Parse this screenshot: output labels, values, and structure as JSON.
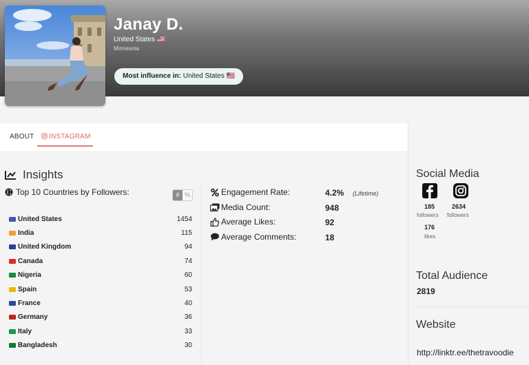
{
  "profile": {
    "name": "Janay D.",
    "country": "United States 🇺🇸",
    "region": "Minnesota",
    "influence_label": "Most influence in:",
    "influence_value": "United States 🇺🇸"
  },
  "tabs": [
    {
      "label": "ABOUT"
    },
    {
      "label": "INSTAGRAM"
    }
  ],
  "insights": {
    "title": "Insights",
    "countries_title": "Top 10 Countries by Followers:",
    "toggle": {
      "on": "#",
      "off": "%"
    },
    "countries": [
      {
        "name": "United States",
        "value": "1454",
        "flag": "#3b5ba9"
      },
      {
        "name": "India",
        "value": "115",
        "flag": "#f39c32"
      },
      {
        "name": "United Kingdom",
        "value": "94",
        "flag": "#2c3e8c"
      },
      {
        "name": "Canada",
        "value": "74",
        "flag": "#d72b2b"
      },
      {
        "name": "Nigeria",
        "value": "60",
        "flag": "#1c8a3c"
      },
      {
        "name": "Spain",
        "value": "53",
        "flag": "#e8b90f"
      },
      {
        "name": "France",
        "value": "40",
        "flag": "#2a4aa8"
      },
      {
        "name": "Germany",
        "value": "36",
        "flag": "#c42020"
      },
      {
        "name": "Italy",
        "value": "33",
        "flag": "#1a9b48"
      },
      {
        "name": "Bangladesh",
        "value": "30",
        "flag": "#0f7a3a"
      }
    ]
  },
  "stats": [
    {
      "icon": "percent-icon",
      "label": "Engagement Rate:",
      "value": "4.2%",
      "note": "(Lifetime)"
    },
    {
      "icon": "images-icon",
      "label": "Media Count:",
      "value": "948",
      "note": ""
    },
    {
      "icon": "thumbs-up-icon",
      "label": "Average Likes:",
      "value": "92",
      "note": ""
    },
    {
      "icon": "comment-icon",
      "label": "Average Comments:",
      "value": "18",
      "note": ""
    }
  ],
  "social": {
    "title": "Social Media",
    "facebook": {
      "followers": "185",
      "followers_label": "followers",
      "likes": "176",
      "likes_label": "likes"
    },
    "instagram": {
      "followers": "2634",
      "followers_label": "followers"
    }
  },
  "audience": {
    "title": "Total Audience",
    "value": "2819"
  },
  "website": {
    "title": "Website",
    "url": "http://linktr.ee/thetravoodie"
  },
  "colors": {
    "accent": "#e06b6b",
    "influence_bg": "#e9f4f3"
  }
}
